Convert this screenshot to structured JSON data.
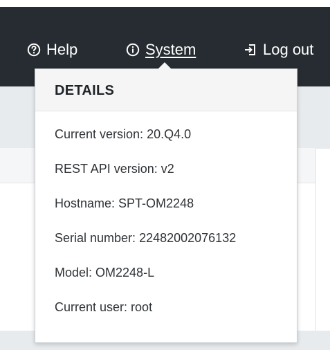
{
  "nav": {
    "help": {
      "icon": "help-circle-icon",
      "label": "Help"
    },
    "system": {
      "icon": "info-circle-icon",
      "label": "System"
    },
    "logout": {
      "icon": "logout-icon",
      "label": "Log out"
    }
  },
  "details_popup": {
    "title": "DETAILS",
    "rows": [
      {
        "label": "Current version:",
        "value": "20.Q4.0"
      },
      {
        "label": "REST API version:",
        "value": "v2"
      },
      {
        "label": "Hostname:",
        "value": "SPT-OM2248"
      },
      {
        "label": "Serial number:",
        "value": "22482002076132"
      },
      {
        "label": "Model:",
        "value": "OM2248-L"
      },
      {
        "label": "Current user:",
        "value": "root"
      }
    ]
  },
  "colors": {
    "topbar_bg": "#262c31",
    "popup_header_bg": "#f5f5f5",
    "page_bg": "#e8ebee"
  }
}
